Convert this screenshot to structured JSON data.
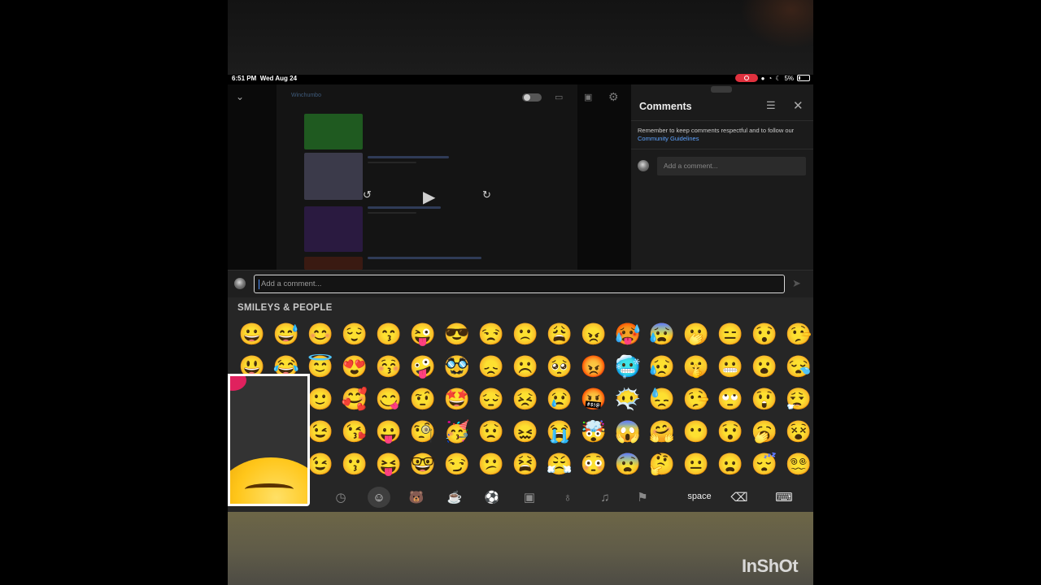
{
  "status": {
    "time": "6:51 PM",
    "date": "Wed Aug 24",
    "battery": "5%"
  },
  "colors": {
    "accent_link": "#5ea3ff",
    "record": "#e0313e",
    "keyboard_bg": "#262626"
  },
  "video": {
    "channel": "Winchumbo",
    "controls": {
      "rewind": "10",
      "forward": "10"
    }
  },
  "comments": {
    "title": "Comments",
    "note_prefix": "Remember to keep comments respectful and to follow our ",
    "note_link": "Community Guidelines",
    "input_placeholder": "Add a comment..."
  },
  "composer": {
    "placeholder": "Add a comment..."
  },
  "keyboard": {
    "section_title": "SMILEYS & PEOPLE",
    "emojis": [
      "😀",
      "😅",
      "😊",
      "😌",
      "😙",
      "😜",
      "😎",
      "😒",
      "🙁",
      "😩",
      "😠",
      "🥵",
      "😰",
      "🫢",
      "😑",
      "😯",
      "🤥",
      "😃",
      "😂",
      "😇",
      "😍",
      "😚",
      "🤪",
      "🥸",
      "😞",
      "☹️",
      "🥺",
      "😡",
      "🥶",
      "😥",
      "🤫",
      "😬",
      "😮",
      "😪",
      "😄",
      "🤣",
      "🙂",
      "🥰",
      "😋",
      "🤨",
      "🤩",
      "😔",
      "😣",
      "😢",
      "🤬",
      "😶‍🌫️",
      "😓",
      "🤥",
      "🙄",
      "😲",
      "😮‍💨",
      "😁",
      "🙃",
      "😉",
      "😘",
      "😛",
      "🧐",
      "🥳",
      "😟",
      "😖",
      "😭",
      "🤯",
      "😱",
      "🤗",
      "😶",
      "😯",
      "🥱",
      "😵",
      "😆",
      "😅",
      "😉",
      "😗",
      "😝",
      "🤓",
      "😏",
      "😕",
      "😫",
      "😤",
      "😳",
      "😨",
      "🤔",
      "😐",
      "😦",
      "😴",
      "😵‍💫"
    ],
    "space_label": "space",
    "categories": [
      "clock-icon",
      "smiley-icon",
      "animal-icon",
      "food-icon",
      "ball-icon",
      "car-icon",
      "bulb-icon",
      "symbols-icon",
      "flag-icon"
    ]
  },
  "watermark": "InShOt"
}
